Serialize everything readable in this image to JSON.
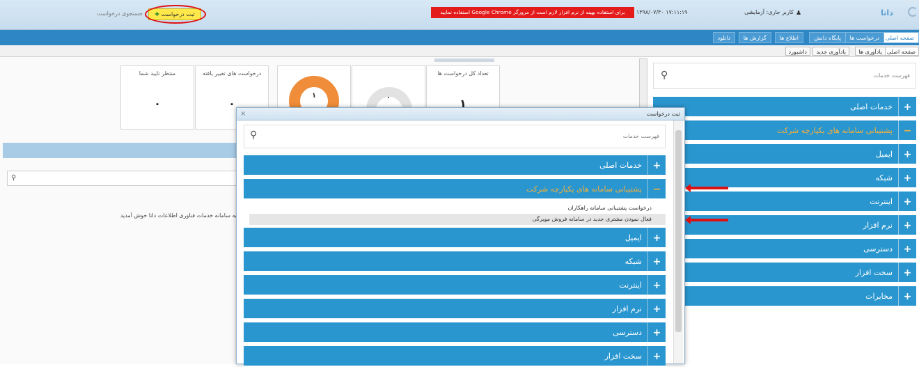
{
  "header": {
    "submit_request": "ثبت درخواست",
    "request_search": "جستجوی درخواست",
    "browser_warning": "برای استفاده بهینه از نرم افزار لازم است از مرورگر Google Chrome استفاده نمایید",
    "datetime": "۱۳۹۸/۰۷/۳۰ ۱۷:۱۱:۱۹",
    "user": "کاربر جاری: آزمایشی",
    "logo": "داتا"
  },
  "nav": {
    "tabs": [
      "صفحه اصلی",
      "درخواست ها",
      "پایگاه دانش",
      "اطلاع ها",
      "گزارش ها",
      "دانلود"
    ]
  },
  "subnav": {
    "tabs": [
      "صفحه اصلی",
      "یادآوری ها",
      "یادآوری جدید",
      "داشبورد"
    ]
  },
  "dashboard": {
    "cards": [
      {
        "title": "تعداد کل درخواست ها",
        "value": "۱"
      },
      {
        "title": "",
        "value": "۰"
      },
      {
        "title": "",
        "value": "۱"
      },
      {
        "title": "درخواست های تغییر یافته",
        "value": "۰"
      },
      {
        "title": "منتظر تایید شما",
        "value": "۰"
      }
    ],
    "welcome": "به سامانه خدمات فناوری اطلاعات داتا خوش آمدید"
  },
  "sidebar": {
    "search_placeholder": "فهرست خدمات",
    "items": [
      "خدمات اصلی",
      "پشتیبانی سامانه های یکپارچه شرکت",
      "ایمیل",
      "شبکه",
      "اینترنت",
      "نرم افزار",
      "دسترسی",
      "سخت افزار",
      "مخابرات"
    ]
  },
  "modal": {
    "title": "ثبت درخواست",
    "search_placeholder": "فهرست خدمات",
    "items": [
      "خدمات اصلی",
      "پشتیبانی سامانه های یکپارچه شرکت",
      "ایمیل",
      "شبکه",
      "اینترنت",
      "نرم افزار",
      "دسترسی",
      "سخت افزار"
    ],
    "sub_items": [
      "درخواست پشتیبانی سامانه راهکاران",
      "فعال نمودن مشتری جدید در سامانه فروش مویرگی"
    ]
  },
  "colors": {
    "accent": "#2a96cf",
    "highlight": "#f5b03a",
    "warning_bg": "#e31b1b",
    "annotation": "#d11"
  }
}
